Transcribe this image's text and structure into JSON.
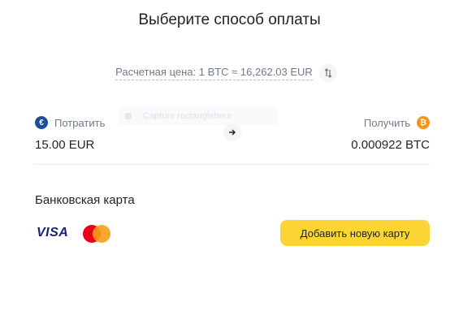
{
  "header": {
    "title": "Выберите способ оплаты"
  },
  "rate": {
    "text": "Расчетная цена: 1 BTC ≈ 16,262.03 EUR",
    "swap_icon": "swap-vertical-icon"
  },
  "ghost": {
    "text": "Capture rectanglehere"
  },
  "spend": {
    "label": "Потратить",
    "currency_symbol": "€",
    "amount": "15.00 EUR",
    "icon": "euro-coin-icon"
  },
  "receive": {
    "label": "Получить",
    "currency_symbol": "₿",
    "amount": "0.000922 BTC",
    "icon": "bitcoin-coin-icon"
  },
  "payment": {
    "section_title": "Банковская карта",
    "visa_label": "VISA",
    "add_card_label": "Добавить новую карту"
  },
  "colors": {
    "accent": "#FCD535",
    "euro": "#1B4F9C",
    "bitcoin": "#F7931A",
    "visa": "#1A1F71",
    "mastercard_red": "#EB001B",
    "mastercard_orange": "#F79E1B",
    "text_primary": "#1E2329",
    "text_secondary": "#707A8A"
  }
}
